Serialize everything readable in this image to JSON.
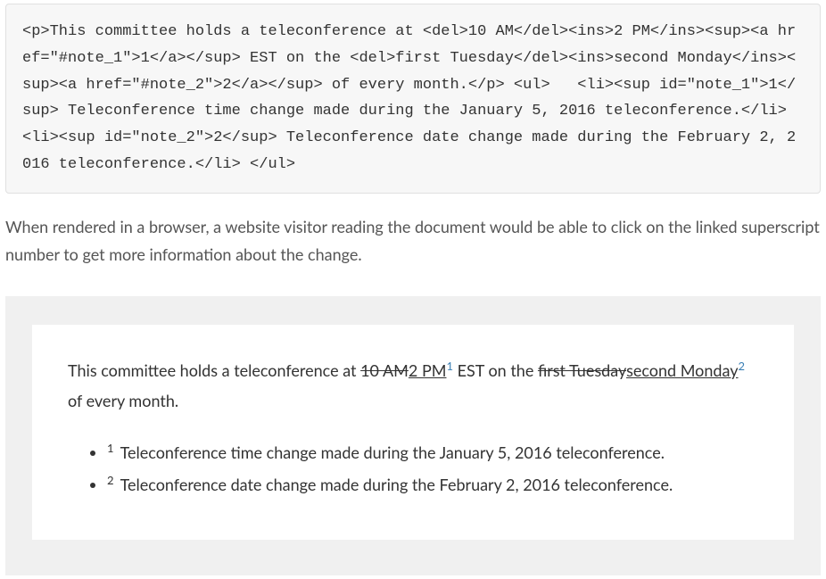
{
  "codeBlock": "<p>This committee holds a teleconference at <del>10 AM</del><ins>2 PM</ins><sup><a href=\"#note_1\">1</a></sup> EST on the <del>first Tuesday</del><ins>second Monday</ins><sup><a href=\"#note_2\">2</a></sup> of every month.</p> <ul>   <li><sup id=\"note_1\">1</sup> Teleconference time change made during the January 5, 2016 teleconference.</li>   <li><sup id=\"note_2\">2</sup> Teleconference date change made during the February 2, 2016 teleconference.</li> </ul>",
  "description": "When rendered in a browser, a website visitor reading the document would be able to click on the linked superscript number to get more information about the change.",
  "rendered": {
    "textBefore": "This committee holds a teleconference at ",
    "del1": "10 AM",
    "ins1": "2 PM",
    "sup1": "1",
    "textMid1": " EST on the ",
    "del2": "first Tuesday",
    "ins2": "second Monday",
    "sup2": "2",
    "textAfter": " of every month."
  },
  "notes": {
    "note1_sup": "1",
    "note1_text": " Teleconference time change made during the January 5, 2016 teleconference.",
    "note2_sup": "2",
    "note2_text": " Teleconference date change made during the February 2, 2016 teleconference."
  }
}
